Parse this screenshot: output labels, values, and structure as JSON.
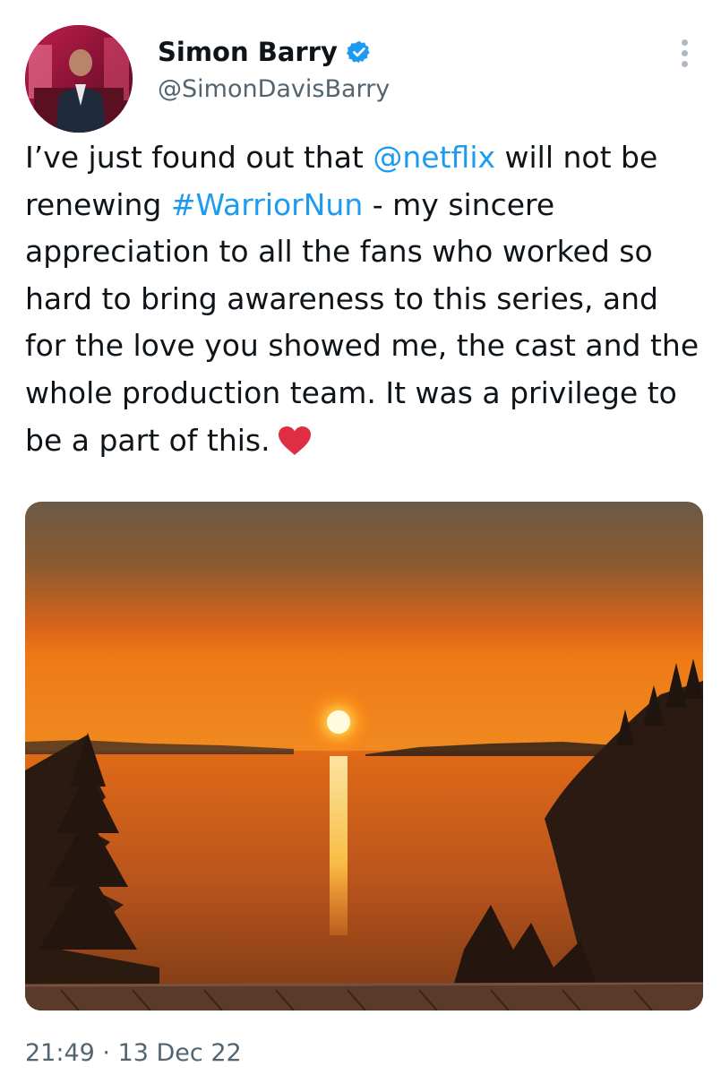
{
  "author": {
    "display_name": "Simon Barry",
    "handle": "@SimonDavisBarry",
    "verified": true,
    "verified_color": "#1d9bf0"
  },
  "tweet": {
    "line1_before": "I’ve just found out that ",
    "mention": "@netflix",
    "line1_after": " will not be renewing ",
    "hashtag": "#WarriorNun",
    "rest": " - my sincere appreciation to all the fans who worked so hard to bring awareness to this series, and for the love you showed me, the cast and the whole production team. It was a privilege to be a part of this.",
    "link_color": "#1d9bf0"
  },
  "icons": {
    "verified": "verified-badge-icon",
    "more": "more-options-icon",
    "heart": "red-heart-emoji"
  },
  "timestamp": {
    "time": "21:49",
    "separator": " · ",
    "date": "13 Dec 22"
  }
}
